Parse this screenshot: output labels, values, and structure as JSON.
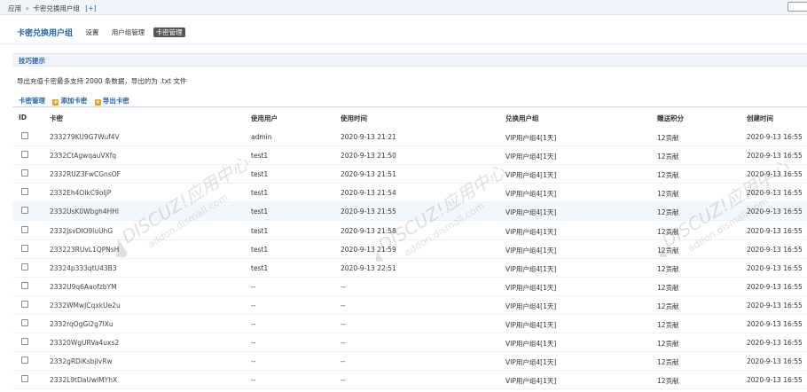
{
  "breadcrumb": {
    "app": "应用",
    "sep": "»",
    "page": "卡密兑换用户组",
    "plus": "[+]"
  },
  "header": {
    "title": "卡密兑换用户组",
    "nav": [
      {
        "label": "设置"
      },
      {
        "label": "用户组管理"
      },
      {
        "label": "卡密管理",
        "active": true
      }
    ]
  },
  "tips": {
    "title": "技巧提示",
    "text": "导出充值卡密最多支持 2000 条数据，导出的为 .txt 文件"
  },
  "section": {
    "title": "卡密管理",
    "add_label": "添加卡密",
    "export_label": "导出卡密"
  },
  "table": {
    "headers": [
      "ID",
      "卡密",
      "使用用户",
      "使用时间",
      "兑换用户组",
      "赠送积分",
      "创建时间"
    ],
    "rows": [
      {
        "code": "233279KU9G7Wuf4V",
        "user": "admin",
        "used_time": "2020-9-13 21:21",
        "group": "VIP用户组4[1天]",
        "points": "12贡献",
        "created": "2020-9-13 16:55"
      },
      {
        "code": "2332CtAgwqauVXfq",
        "user": "test1",
        "used_time": "2020-9-13 21:50",
        "group": "VIP用户组4[1天]",
        "points": "12贡献",
        "created": "2020-9-13 16:55"
      },
      {
        "code": "2332RUZ3FwCGnsOF",
        "user": "test1",
        "used_time": "2020-9-13 21:51",
        "group": "VIP用户组4[1天]",
        "points": "12贡献",
        "created": "2020-9-13 16:55"
      },
      {
        "code": "2332Eh4OIkC9oIjP",
        "user": "test1",
        "used_time": "2020-9-13 21:54",
        "group": "VIP用户组4[1天]",
        "points": "12贡献",
        "created": "2020-9-13 16:55"
      },
      {
        "code": "2332UsK0Wbgh4HHl",
        "user": "test1",
        "used_time": "2020-9-13 21:55",
        "group": "VIP用户组4[1天]",
        "points": "12贡献",
        "created": "2020-9-13 16:55"
      },
      {
        "code": "2332JsvDIO9luUhG",
        "user": "test1",
        "used_time": "2020-9-13 21:58",
        "group": "VIP用户组4[1天]",
        "points": "12贡献",
        "created": "2020-9-13 16:55"
      },
      {
        "code": "233223RUvL1QPNsH",
        "user": "test1",
        "used_time": "2020-9-13 21:59",
        "group": "VIP用户组4[1天]",
        "points": "12贡献",
        "created": "2020-9-13 16:55"
      },
      {
        "code": "23324p333qtU43B3",
        "user": "test1",
        "used_time": "2020-9-13 22:51",
        "group": "VIP用户组4[1天]",
        "points": "12贡献",
        "created": "2020-9-13 16:55"
      },
      {
        "code": "2332U9q6AaofzbYM",
        "user": "--",
        "used_time": "--",
        "group": "VIP用户组4[1天]",
        "points": "12贡献",
        "created": "2020-9-13 16:55"
      },
      {
        "code": "2332WMwJCqxkUe2u",
        "user": "--",
        "used_time": "--",
        "group": "VIP用户组4[1天]",
        "points": "12贡献",
        "created": "2020-9-13 16:55"
      },
      {
        "code": "2332rqOgGi2g7lXu",
        "user": "--",
        "used_time": "--",
        "group": "VIP用户组4[1天]",
        "points": "12贡献",
        "created": "2020-9-13 16:55"
      },
      {
        "code": "23320WgURVa4uxs2",
        "user": "--",
        "used_time": "--",
        "group": "VIP用户组4[1天]",
        "points": "12贡献",
        "created": "2020-9-13 16:55"
      },
      {
        "code": "2332gRDiKsbjIvRw",
        "user": "--",
        "used_time": "--",
        "group": "VIP用户组4[1天]",
        "points": "12贡献",
        "created": "2020-9-13 16:55"
      },
      {
        "code": "2332L9tDaUwIMYhX",
        "user": "--",
        "used_time": "--",
        "group": "VIP用户组4[1天]",
        "points": "12贡献",
        "created": "2020-9-13 16:55"
      }
    ]
  },
  "watermark": {
    "brand": "DISCUZ!应用中心",
    "domain": "addon.dismall.com",
    "mark": "贰道"
  },
  "colors": {
    "accent": "#2366a8",
    "orange": "#f09a1a",
    "active_tab": "#555555",
    "row_highlight": "#f2f7fc"
  }
}
